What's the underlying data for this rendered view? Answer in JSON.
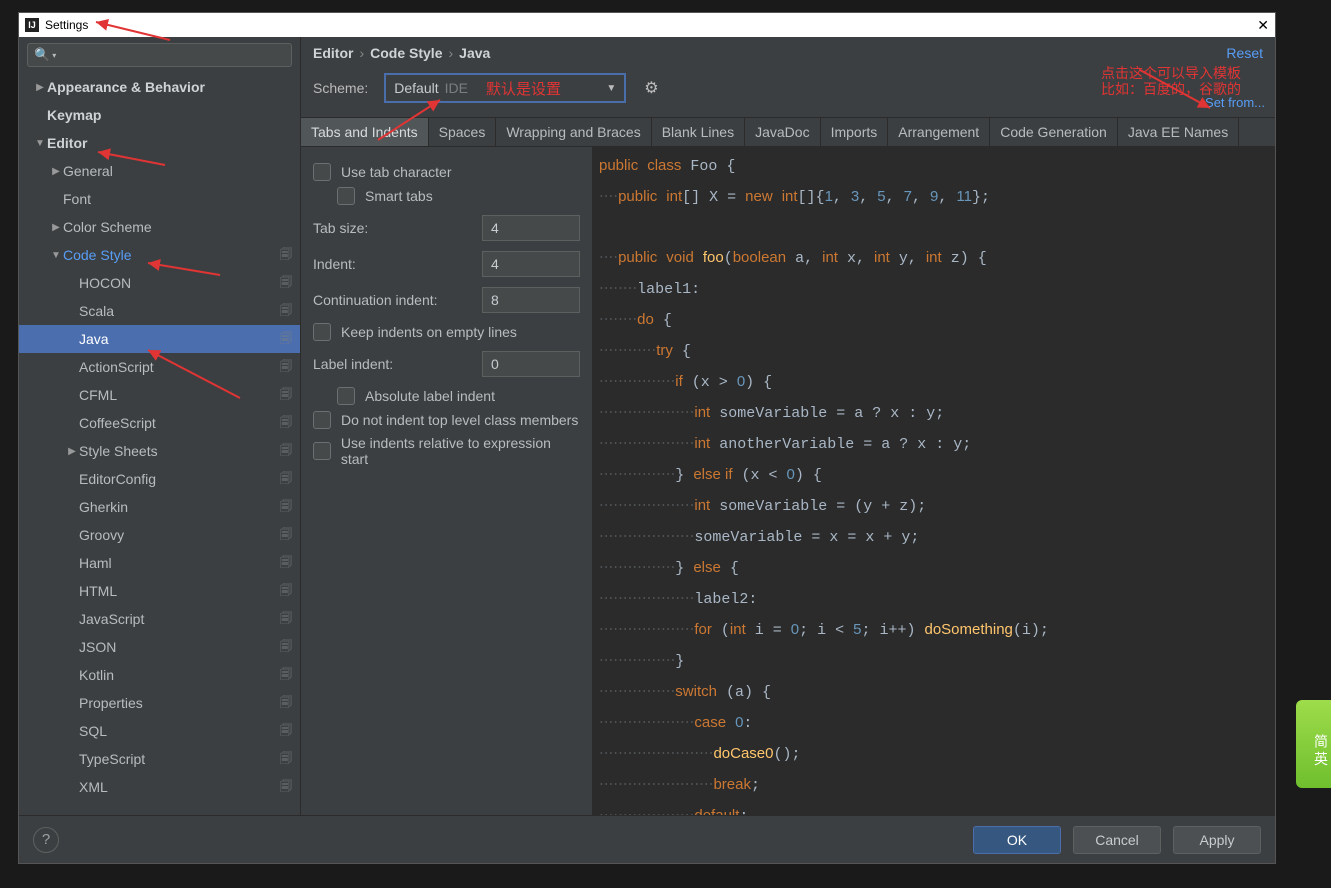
{
  "title": "Settings",
  "breadcrumb": [
    "Editor",
    "Code Style",
    "Java"
  ],
  "reset": "Reset",
  "scheme": {
    "label": "Scheme:",
    "value": "Default",
    "tag": "IDE",
    "note": "默认是设置",
    "setfrom": "Set from...",
    "anno1": "点击这个可以导入模板",
    "anno2": "比如：百度的，谷歌的"
  },
  "sidebar": {
    "items": [
      {
        "label": "Appearance & Behavior",
        "level": 1,
        "bold": true,
        "arrow": "▶"
      },
      {
        "label": "Keymap",
        "level": 1,
        "bold": true
      },
      {
        "label": "Editor",
        "level": 1,
        "bold": true,
        "arrow": "▼"
      },
      {
        "label": "General",
        "level": 2,
        "arrow": "▶"
      },
      {
        "label": "Font",
        "level": 2
      },
      {
        "label": "Color Scheme",
        "level": 2,
        "arrow": "▶"
      },
      {
        "label": "Code Style",
        "level": 2,
        "arrow": "▼",
        "blue": true,
        "folder": true
      },
      {
        "label": "HOCON",
        "level": 3,
        "folder": true
      },
      {
        "label": "Scala",
        "level": 3,
        "folder": true
      },
      {
        "label": "Java",
        "level": 3,
        "folder": true,
        "selected": true
      },
      {
        "label": "ActionScript",
        "level": 3,
        "folder": true
      },
      {
        "label": "CFML",
        "level": 3,
        "folder": true
      },
      {
        "label": "CoffeeScript",
        "level": 3,
        "folder": true
      },
      {
        "label": "Style Sheets",
        "level": 3,
        "folder": true,
        "arrow": "▶"
      },
      {
        "label": "EditorConfig",
        "level": 3,
        "folder": true
      },
      {
        "label": "Gherkin",
        "level": 3,
        "folder": true
      },
      {
        "label": "Groovy",
        "level": 3,
        "folder": true
      },
      {
        "label": "Haml",
        "level": 3,
        "folder": true
      },
      {
        "label": "HTML",
        "level": 3,
        "folder": true
      },
      {
        "label": "JavaScript",
        "level": 3,
        "folder": true
      },
      {
        "label": "JSON",
        "level": 3,
        "folder": true
      },
      {
        "label": "Kotlin",
        "level": 3,
        "folder": true
      },
      {
        "label": "Properties",
        "level": 3,
        "folder": true
      },
      {
        "label": "SQL",
        "level": 3,
        "folder": true
      },
      {
        "label": "TypeScript",
        "level": 3,
        "folder": true
      },
      {
        "label": "XML",
        "level": 3,
        "folder": true
      }
    ]
  },
  "tabs": [
    "Tabs and Indents",
    "Spaces",
    "Wrapping and Braces",
    "Blank Lines",
    "JavaDoc",
    "Imports",
    "Arrangement",
    "Code Generation",
    "Java EE Names"
  ],
  "form": {
    "use_tab": "Use tab character",
    "smart_tabs": "Smart tabs",
    "tab_size": {
      "label": "Tab size:",
      "value": "4"
    },
    "indent": {
      "label": "Indent:",
      "value": "4"
    },
    "cont": {
      "label": "Continuation indent:",
      "value": "8"
    },
    "keep_empty": "Keep indents on empty lines",
    "label_indent": {
      "label": "Label indent:",
      "value": "0"
    },
    "abs_label": "Absolute label indent",
    "no_top": "Do not indent top level class members",
    "rel_expr": "Use indents relative to expression start"
  },
  "buttons": {
    "ok": "OK",
    "cancel": "Cancel",
    "apply": "Apply"
  },
  "badge": "简 英"
}
